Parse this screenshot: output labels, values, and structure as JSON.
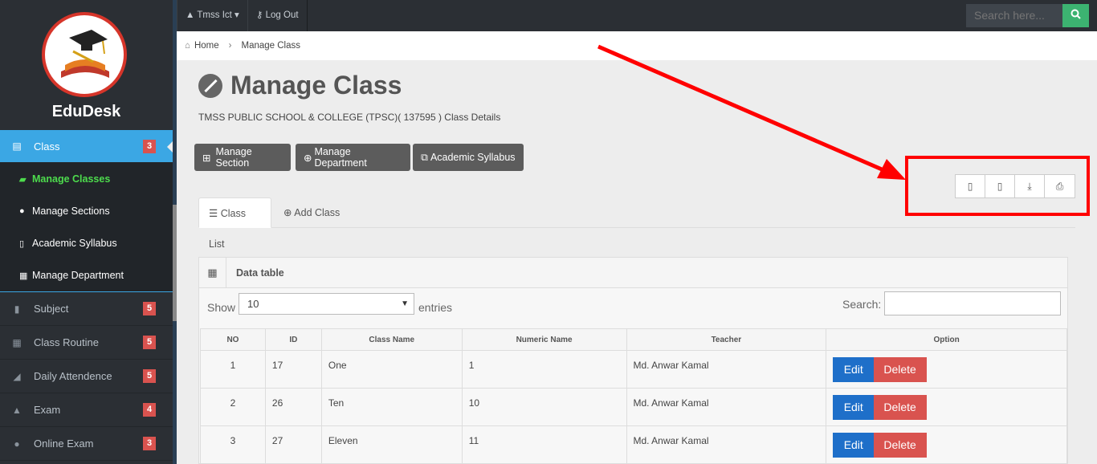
{
  "app": {
    "brand": "EduDesk"
  },
  "topbar": {
    "user_label": "Tmss Ict",
    "logout_label": "Log Out",
    "search_placeholder": "Search here..."
  },
  "breadcrumb": {
    "home": "Home",
    "current": "Manage Class"
  },
  "sidebar": {
    "class": {
      "label": "Class",
      "badge": "3"
    },
    "sub_items": [
      {
        "label": "Manage Classes"
      },
      {
        "label": "Manage Sections"
      },
      {
        "label": "Academic Syllabus"
      },
      {
        "label": "Manage Department"
      }
    ],
    "items": [
      {
        "label": "Subject",
        "badge": "5"
      },
      {
        "label": "Class Routine",
        "badge": "5"
      },
      {
        "label": "Daily Attendence",
        "badge": "5"
      },
      {
        "label": "Exam",
        "badge": "4"
      },
      {
        "label": "Online Exam",
        "badge": "3"
      }
    ]
  },
  "page": {
    "title": "Manage Class",
    "subtitle": "TMSS PUBLIC SCHOOL & COLLEGE (TPSC)( 137595 ) Class Details",
    "buttons": {
      "manage_section": "Manage Section",
      "manage_department": "Manage Department",
      "academic_syllabus": "Academic Syllabus"
    },
    "tabs": {
      "class_list": "Class List",
      "add_class": "Add Class"
    }
  },
  "datatable": {
    "title": "Data table",
    "show_label": "Show",
    "page_size": "10",
    "entries_label": "entries",
    "search_label": "Search:",
    "columns": [
      "NO",
      "ID",
      "Class Name",
      "Numeric Name",
      "Teacher",
      "Option"
    ],
    "rows": [
      {
        "no": "1",
        "id": "17",
        "class_name": "One",
        "numeric_name": "1",
        "teacher": "Md. Anwar Kamal"
      },
      {
        "no": "2",
        "id": "26",
        "class_name": "Ten",
        "numeric_name": "10",
        "teacher": "Md. Anwar Kamal"
      },
      {
        "no": "3",
        "id": "27",
        "class_name": "Eleven",
        "numeric_name": "11",
        "teacher": "Md. Anwar Kamal"
      }
    ],
    "edit_label": "Edit",
    "delete_label": "Delete"
  },
  "colors": {
    "accent": "#3ba7e4",
    "danger": "#d9534f",
    "primary": "#1e6fc9",
    "annotation": "#ff0000"
  }
}
